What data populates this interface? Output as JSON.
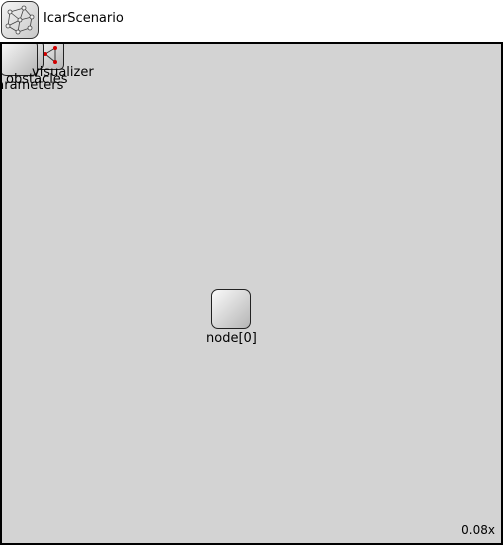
{
  "header": {
    "title": "IcarScenario",
    "icon": "network-icon"
  },
  "canvas": {
    "background": "#d3d3d3",
    "submodules": [
      {
        "label": "parameters",
        "icon": "module-icon"
      },
      {
        "label": "visualizer",
        "icon": "visualizer-icon"
      },
      {
        "label": "obstacles",
        "icon": "module-icon"
      },
      {
        "label": "node[0]",
        "icon": "module-icon"
      }
    ],
    "zoom": "0.08x"
  }
}
